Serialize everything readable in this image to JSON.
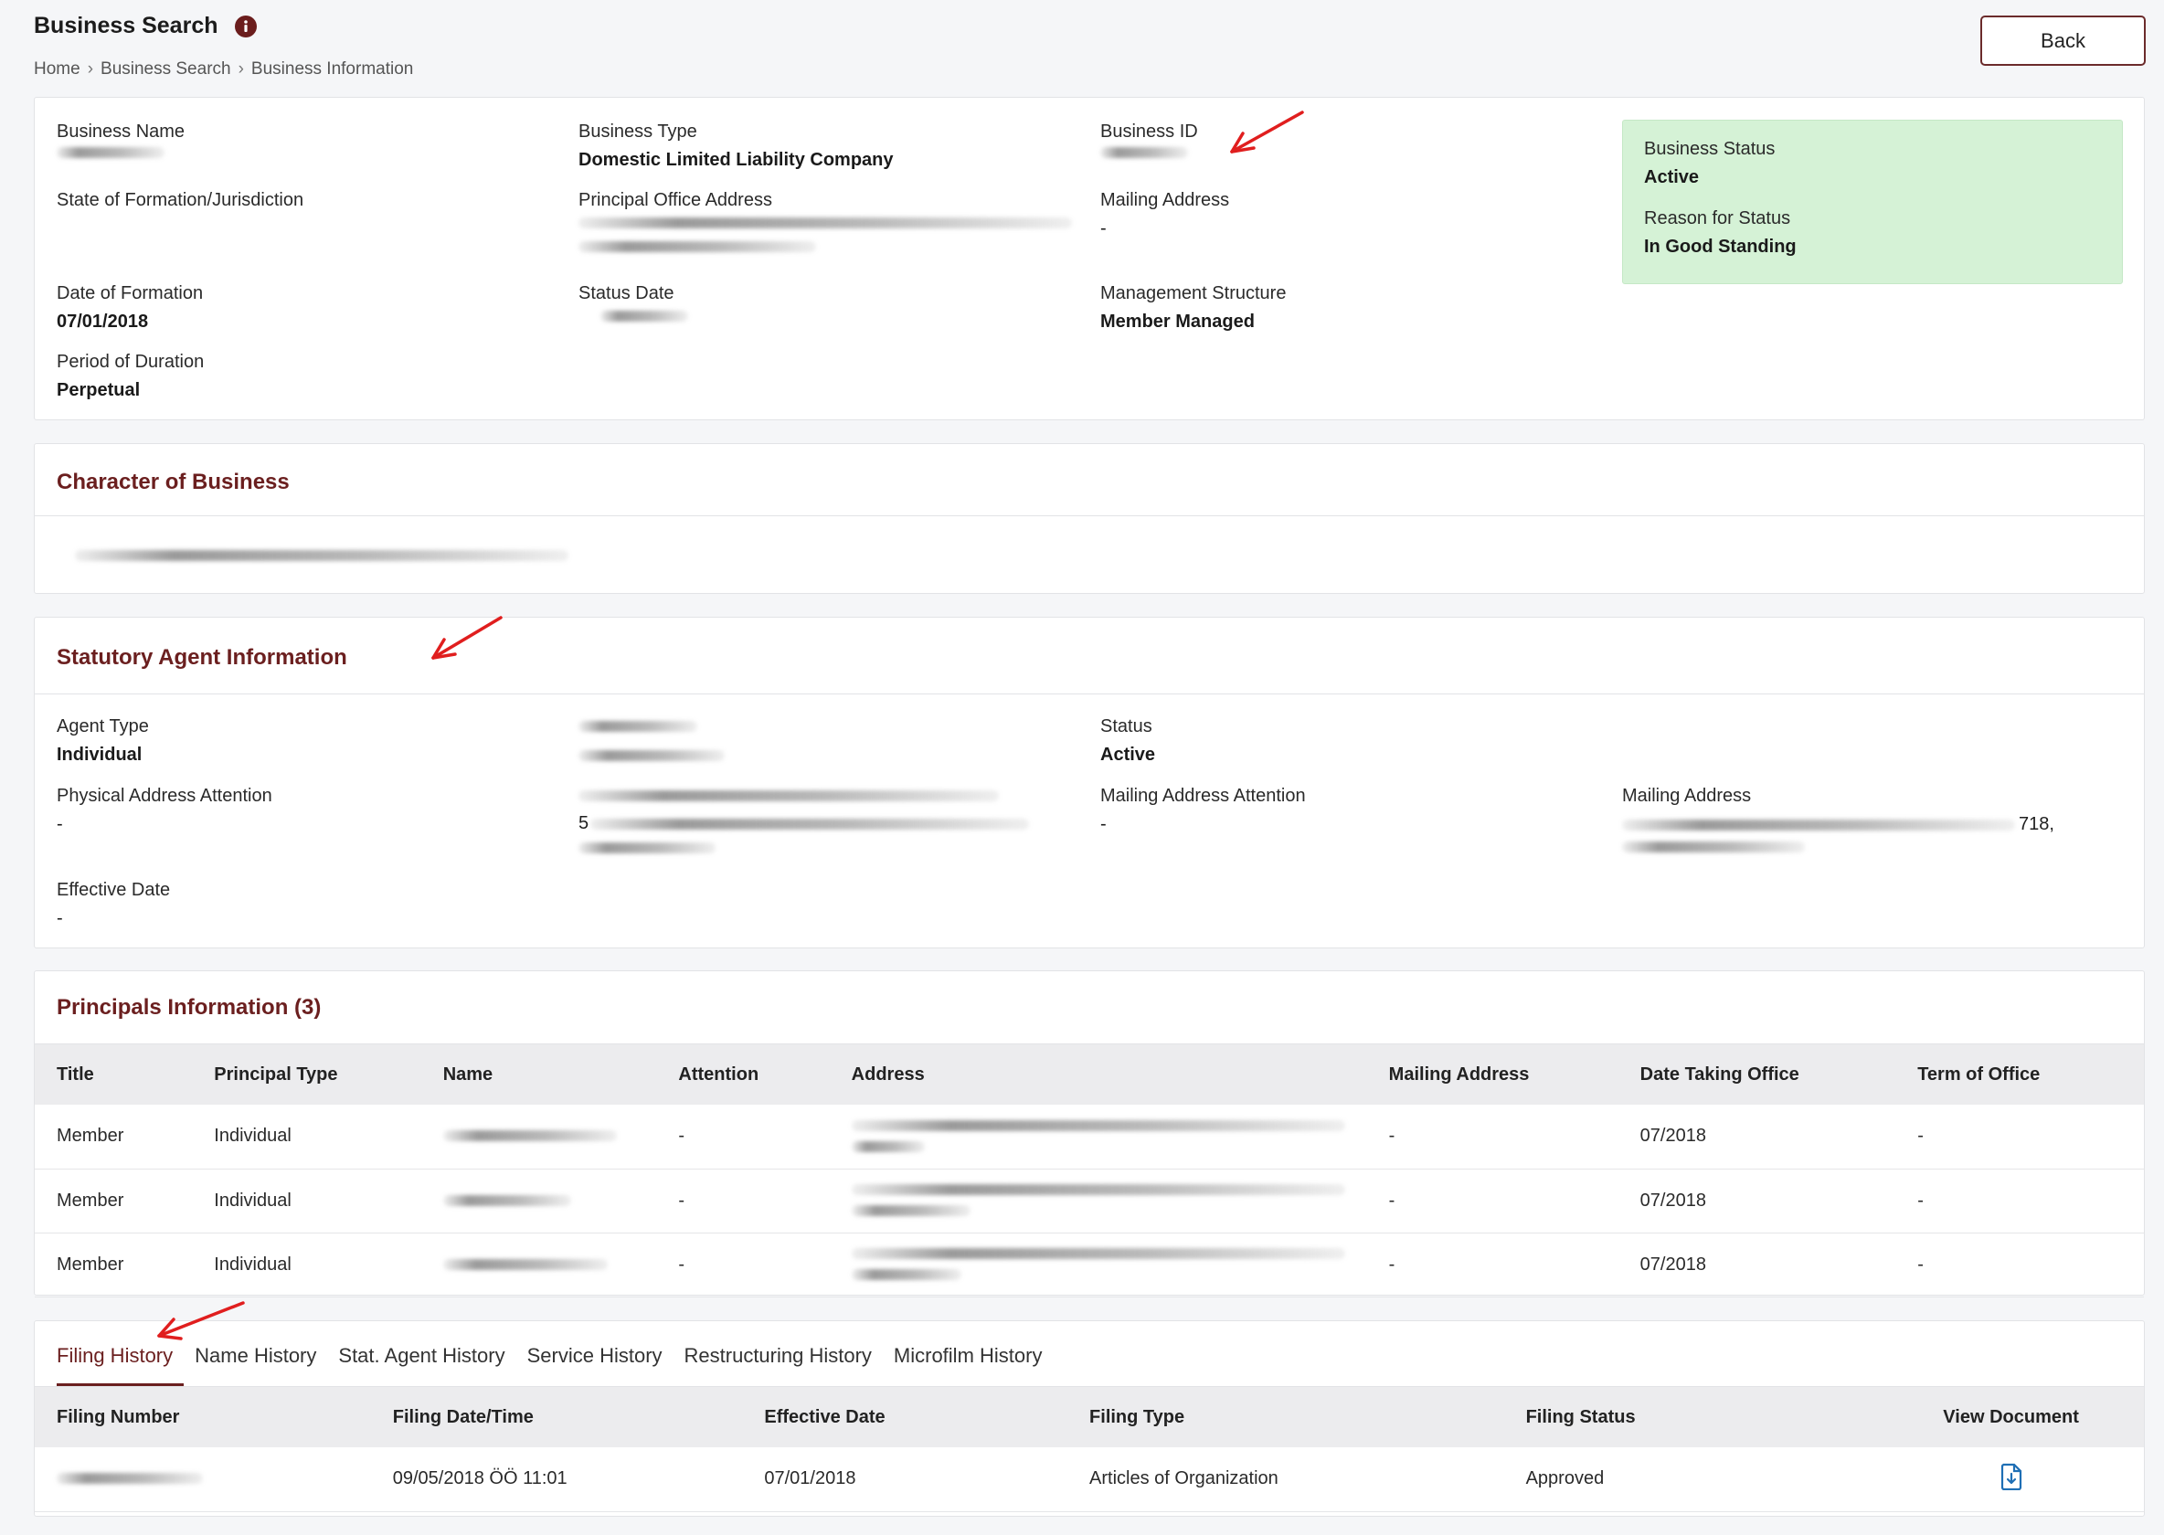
{
  "header": {
    "title": "Business Search",
    "breadcrumb": [
      "Home",
      "Business Search",
      "Business Information"
    ],
    "back_label": "Back"
  },
  "business": {
    "name_label": "Business Name",
    "type_label": "Business Type",
    "type_value": "Domestic Limited Liability Company",
    "id_label": "Business ID",
    "state_label": "State of Formation/Jurisdiction",
    "principal_office_label": "Principal Office Address",
    "mailing_label": "Mailing Address",
    "mailing_value": "-",
    "formation_date_label": "Date of Formation",
    "formation_date_value": "07/01/2018",
    "status_date_label": "Status Date",
    "management_label": "Management Structure",
    "management_value": "Member Managed",
    "duration_label": "Period of Duration",
    "duration_value": "Perpetual",
    "status_label": "Business Status",
    "status_value": "Active",
    "reason_label": "Reason for Status",
    "reason_value": "In Good Standing",
    "status_color": "#d5f2d6"
  },
  "character": {
    "title": "Character of Business"
  },
  "agent": {
    "title": "Statutory Agent Information",
    "type_label": "Agent Type",
    "type_value": "Individual",
    "status_label": "Status",
    "status_value": "Active",
    "physical_attention_label": "Physical Address Attention",
    "physical_attention_value": "-",
    "physical_address_partial": "5",
    "mailing_attention_label": "Mailing Address Attention",
    "mailing_attention_value": "-",
    "mailing_address_label": "Mailing Address",
    "mailing_address_partial": "718,",
    "effective_label": "Effective Date",
    "effective_value": "-"
  },
  "principals": {
    "title": "Principals Information (3)",
    "columns": [
      "Title",
      "Principal Type",
      "Name",
      "Attention",
      "Address",
      "Mailing Address",
      "Date Taking Office",
      "Term of Office"
    ],
    "rows": [
      {
        "title": "Member",
        "type": "Individual",
        "attention": "-",
        "mailing": "-",
        "date": "07/2018",
        "term": "-"
      },
      {
        "title": "Member",
        "type": "Individual",
        "attention": "-",
        "mailing": "-",
        "date": "07/2018",
        "term": "-"
      },
      {
        "title": "Member",
        "type": "Individual",
        "attention": "-",
        "mailing": "-",
        "date": "07/2018",
        "term": "-"
      }
    ]
  },
  "history": {
    "tabs": [
      "Filing History",
      "Name History",
      "Stat. Agent History",
      "Service History",
      "Restructuring History",
      "Microfilm History"
    ],
    "columns": [
      "Filing Number",
      "Filing Date/Time",
      "Effective Date",
      "Filing Type",
      "Filing Status",
      "View Document"
    ],
    "rows": [
      {
        "date_time": "09/05/2018 ÖÖ 11:01",
        "effective": "07/01/2018",
        "type": "Articles of Organization",
        "status": "Approved"
      }
    ]
  },
  "colors": {
    "accent": "#6b1f1f",
    "annotation_arrow": "#e01e1e"
  },
  "icons": [
    "info-icon",
    "download-document-icon",
    "red-arrow-annotation"
  ]
}
